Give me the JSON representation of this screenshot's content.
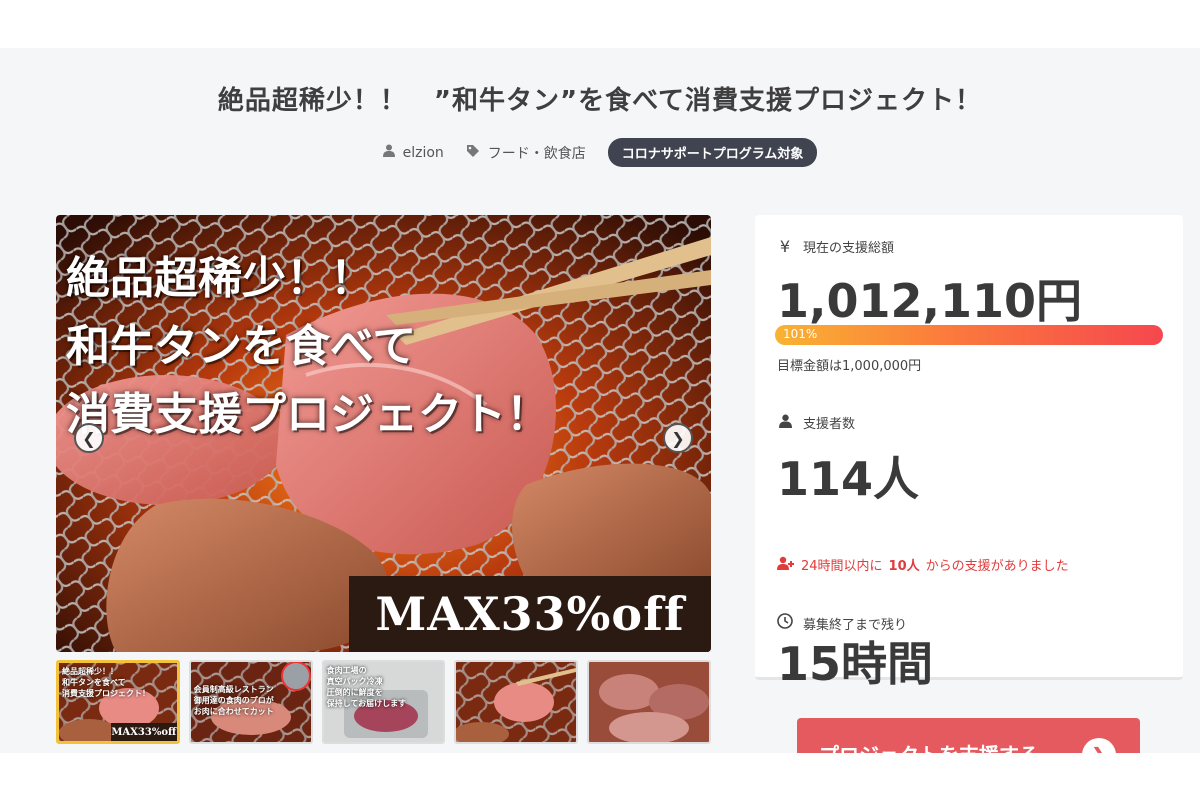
{
  "project": {
    "title": "絶品超稀少！！　”和牛タン”を食べて消費支援プロジェクト！",
    "author": "elzion",
    "category": "フード・飲食店",
    "badge": "コロナサポートプログラム対象"
  },
  "hero": {
    "overlay_lines": [
      "絶品超稀少！！",
      "和牛タンを食べて",
      "消費支援プロジェクト！"
    ],
    "banner": "MAX33%off",
    "prev_icon": "chevron-left-icon",
    "next_icon": "chevron-right-icon"
  },
  "thumbnails": [
    {
      "text": [
        "絶品超稀少！！",
        "和牛タンを食べて",
        "消費支援プロジェクト！"
      ],
      "banner": "MAX33%off",
      "active": true
    },
    {
      "text": [
        "会員制高級レストラン",
        "御用達の食肉のプロが",
        "お肉に合わせてカット"
      ],
      "banner": "",
      "active": false
    },
    {
      "text": [
        "食肉工場の",
        "真空パック冷凍",
        "圧倒的に鮮度を",
        "保持してお届けします"
      ],
      "banner": "",
      "active": false
    },
    {
      "text": [],
      "banner": "",
      "active": false
    },
    {
      "text": [],
      "banner": "",
      "active": false
    }
  ],
  "stats": {
    "amount_label": "現在の支援総額",
    "amount_icon": "yen-icon",
    "amount_value": "1,012,110円",
    "progress_text": "101%",
    "progress": 1.01,
    "goal_text": "目標金額は1,000,000円",
    "backers_label": "支援者数",
    "backers_icon": "user-icon",
    "backers_value": "114人",
    "recent_prefix": "24時間以内に",
    "recent_count": "10人",
    "recent_suffix": "からの支援がありました",
    "remaining_label": "募集終了まで残り",
    "remaining_icon": "clock-icon",
    "remaining_value": "15時間"
  },
  "support_button": {
    "label": "プロジェクトを支援する",
    "icon": "arrow-right-circle-icon"
  },
  "colors": {
    "accent": "#e45a5f",
    "badge_bg": "#3f4450",
    "alert": "#e23b3b"
  }
}
